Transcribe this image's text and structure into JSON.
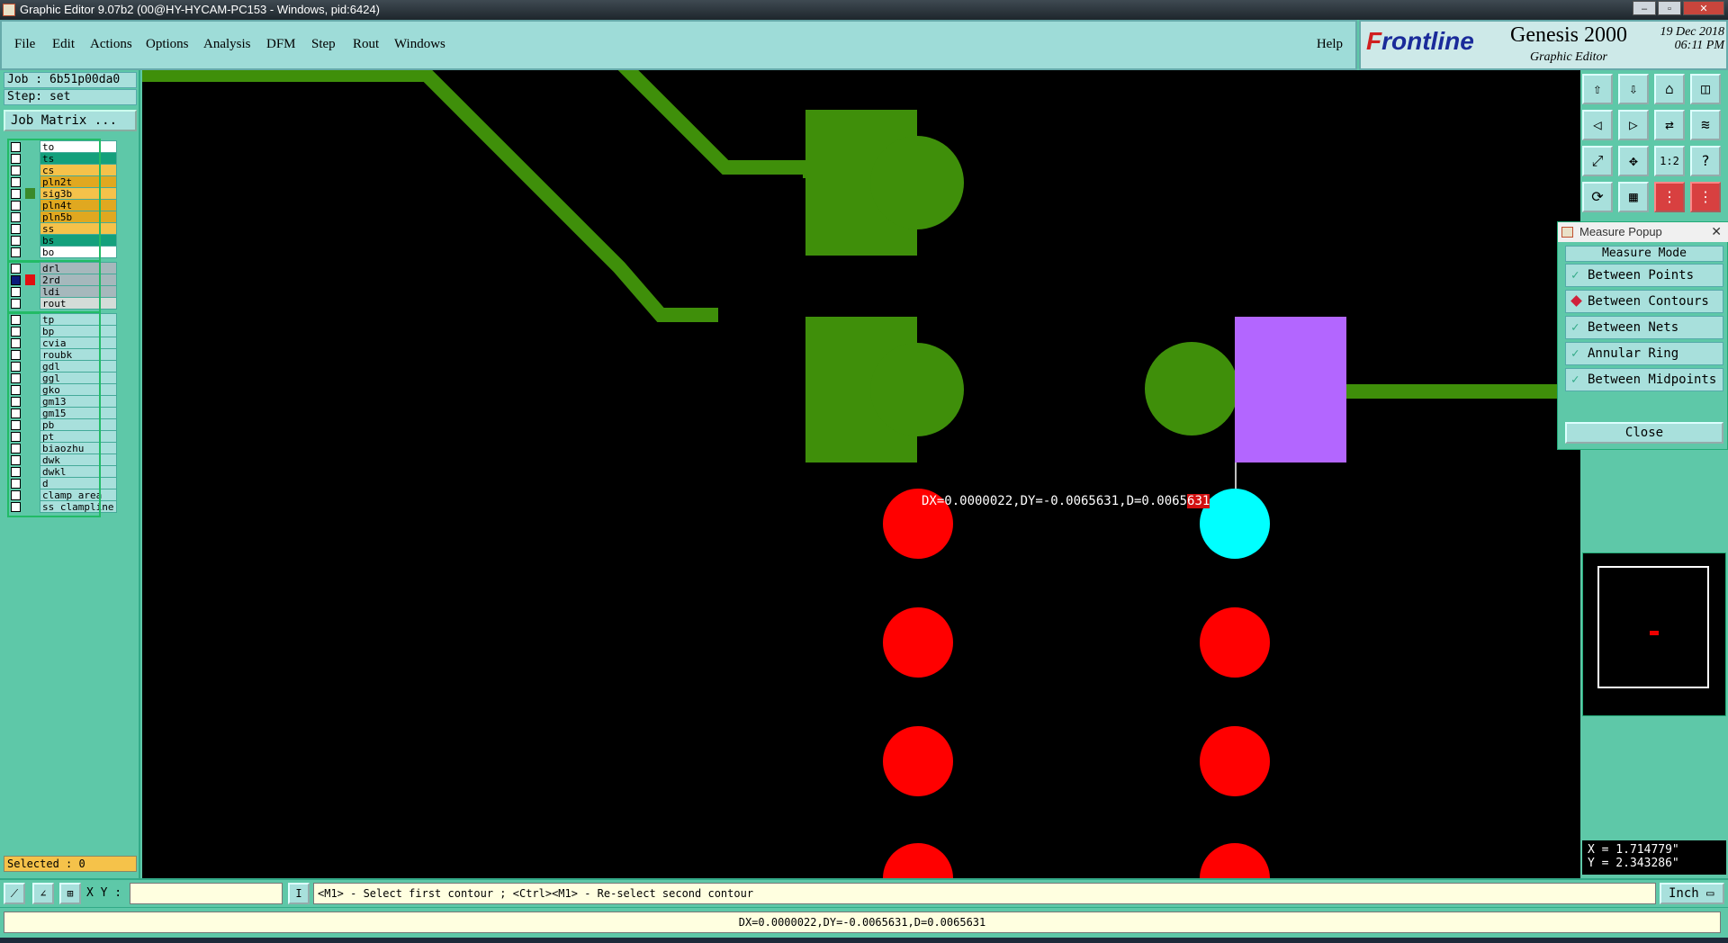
{
  "window": {
    "title": "Graphic Editor 9.07b2 (00@HY-HYCAM-PC153 - Windows, pid:6424)",
    "controls": [
      "–",
      "▫",
      "✕"
    ]
  },
  "menu": {
    "items": [
      "File",
      "Edit",
      "Actions",
      "Options",
      "Analysis",
      "DFM",
      "Step",
      "Rout",
      "Windows"
    ],
    "help": "Help"
  },
  "logo": {
    "brand_prefix": "F",
    "brand_rest": "rontline",
    "product": "Genesis 2000",
    "subtitle": "Graphic Editor",
    "date": "19 Dec 2018",
    "time": "06:11 PM"
  },
  "job": {
    "job_label": "Job : 6b51p00da0",
    "step_label": "Step: set",
    "matrix_button": "Job Matrix ..."
  },
  "layers": [
    {
      "name": "to",
      "color": "#ffffff",
      "checked": false
    },
    {
      "name": "ts",
      "color": "#14a07c",
      "checked": false
    },
    {
      "name": "cs",
      "color": "#f5c24a",
      "checked": false
    },
    {
      "name": "pln2t",
      "color": "#e0a820",
      "checked": false
    },
    {
      "name": "sig3b",
      "color": "#f5c24a",
      "checked": false,
      "indicator": "#3a8a2a"
    },
    {
      "name": "pln4t",
      "color": "#e0a820",
      "checked": false
    },
    {
      "name": "pln5b",
      "color": "#e0a820",
      "checked": false
    },
    {
      "name": "ss",
      "color": "#f5c24a",
      "checked": false
    },
    {
      "name": "bs",
      "color": "#14a07c",
      "checked": false
    },
    {
      "name": "bo",
      "color": "#ffffff",
      "checked": false
    },
    {
      "name": "drl",
      "color": "#a6b8bc",
      "checked": false
    },
    {
      "name": "2rd",
      "color": "#a6b8bc",
      "checked": true,
      "indicator": "#e01010"
    },
    {
      "name": "ldi",
      "color": "#a6b8bc",
      "checked": false
    },
    {
      "name": "rout",
      "color": "#d4dcd8",
      "checked": false
    },
    {
      "name": "tp",
      "color": "#a8e0dc",
      "checked": false
    },
    {
      "name": "bp",
      "color": "#a8e0dc",
      "checked": false
    },
    {
      "name": "cvia",
      "color": "#a8e0dc",
      "checked": false
    },
    {
      "name": "roubk",
      "color": "#a8e0dc",
      "checked": false
    },
    {
      "name": "gdl",
      "color": "#a8e0dc",
      "checked": false
    },
    {
      "name": "ggl",
      "color": "#a8e0dc",
      "checked": false
    },
    {
      "name": "gko",
      "color": "#a8e0dc",
      "checked": false
    },
    {
      "name": "gm13",
      "color": "#a8e0dc",
      "checked": false
    },
    {
      "name": "gm15",
      "color": "#a8e0dc",
      "checked": false
    },
    {
      "name": "pb",
      "color": "#a8e0dc",
      "checked": false
    },
    {
      "name": "pt",
      "color": "#a8e0dc",
      "checked": false
    },
    {
      "name": "biaozhu",
      "color": "#a8e0dc",
      "checked": false
    },
    {
      "name": "dwk",
      "color": "#a8e0dc",
      "checked": false
    },
    {
      "name": "dwkl",
      "color": "#a8e0dc",
      "checked": false
    },
    {
      "name": "d",
      "color": "#a8e0dc",
      "checked": false
    },
    {
      "name": "clamp_area",
      "color": "#a8e0dc",
      "checked": false
    },
    {
      "name": "ss_clampline",
      "color": "#a8e0dc",
      "checked": false
    }
  ],
  "selected_label": "Selected : 0",
  "canvas": {
    "measure_text_main": "DX=0.0000022,DY=-0.0065631,D=0.0065",
    "measure_text_highlight": "631",
    "colors": {
      "trace": "#3f8f0a",
      "drill": "#ff0000",
      "selected_drill": "#00ffff",
      "pad_selected": "#b366ff",
      "background": "#000000"
    }
  },
  "toolbar": {
    "icons": [
      "layer-up-icon",
      "layer-down-icon",
      "home-icon",
      "split-view-icon",
      "pan-left-icon",
      "pan-right-icon",
      "swap-icon",
      "snap-icon",
      "zoom-fit-icon",
      "zoom-center-icon",
      "scale-icon",
      "help-icon",
      "rotate-icon",
      "grid-icon",
      "net-red-icon",
      "net-red-2-icon"
    ],
    "glyphs": [
      "⇧",
      "⇩",
      "⌂",
      "◫",
      "◁",
      "▷",
      "⇄",
      "≋",
      "⤢",
      "✥",
      "1:2",
      "?",
      "⟳",
      "▦",
      "⋮",
      "⋮"
    ],
    "scale_label": "1:2"
  },
  "measure_popup": {
    "title": "Measure Popup",
    "mode_header": "Measure Mode",
    "modes": [
      {
        "label": "Between Points",
        "selected": false
      },
      {
        "label": "Between Contours",
        "selected": true
      },
      {
        "label": "Between Nets",
        "selected": false
      },
      {
        "label": "Annular Ring",
        "selected": false
      },
      {
        "label": "Between Midpoints",
        "selected": false
      }
    ],
    "close_label": "Close"
  },
  "coords": {
    "x": "X = 1.714779\"",
    "y": "Y = 2.343286\""
  },
  "command": {
    "xy_label": "X Y :",
    "xy_value": "",
    "prompt": "<M1> - Select first contour ; <Ctrl><M1> - Re-select second contour",
    "unit": "Inch"
  },
  "message": "DX=0.0000022,DY=-0.0065631,D=0.0065631"
}
